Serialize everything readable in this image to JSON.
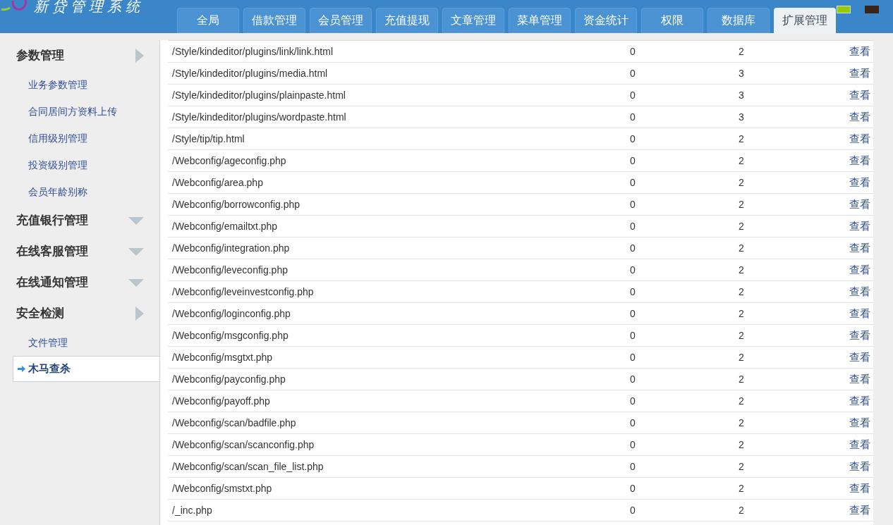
{
  "logo": {
    "title": "新贷管理系统"
  },
  "tabs": [
    {
      "label": "全局",
      "selected": false
    },
    {
      "label": "借款管理",
      "selected": false
    },
    {
      "label": "会员管理",
      "selected": false
    },
    {
      "label": "充值提现",
      "selected": false
    },
    {
      "label": "文章管理",
      "selected": false
    },
    {
      "label": "菜单管理",
      "selected": false
    },
    {
      "label": "资金统计",
      "selected": false
    },
    {
      "label": "权限",
      "selected": false
    },
    {
      "label": "数据库",
      "selected": false
    },
    {
      "label": "扩展管理",
      "selected": true
    }
  ],
  "sidebar": [
    {
      "label": "参数管理",
      "expanded": true,
      "children": [
        {
          "label": "业务参数管理",
          "selected": false
        },
        {
          "label": "合同居间方资料上传",
          "selected": false
        },
        {
          "label": "信用级别管理",
          "selected": false
        },
        {
          "label": "投资级别管理",
          "selected": false
        },
        {
          "label": "会员年龄别称",
          "selected": false
        }
      ]
    },
    {
      "label": "充值银行管理",
      "expanded": false
    },
    {
      "label": "在线客服管理",
      "expanded": false
    },
    {
      "label": "在线通知管理",
      "expanded": false
    },
    {
      "label": "安全检测",
      "expanded": true,
      "children": [
        {
          "label": "文件管理",
          "selected": false
        },
        {
          "label": "木马查杀",
          "selected": true
        }
      ]
    }
  ],
  "table": {
    "rows": [
      [
        "/Style/kindeditor/plugins/link/link.html",
        "0",
        "2",
        "查看"
      ],
      [
        "/Style/kindeditor/plugins/media.html",
        "0",
        "3",
        "查看"
      ],
      [
        "/Style/kindeditor/plugins/plainpaste.html",
        "0",
        "3",
        "查看"
      ],
      [
        "/Style/kindeditor/plugins/wordpaste.html",
        "0",
        "3",
        "查看"
      ],
      [
        "/Style/tip/tip.html",
        "0",
        "2",
        "查看"
      ],
      [
        "/Webconfig/ageconfig.php",
        "0",
        "2",
        "查看"
      ],
      [
        "/Webconfig/area.php",
        "0",
        "2",
        "查看"
      ],
      [
        "/Webconfig/borrowconfig.php",
        "0",
        "2",
        "查看"
      ],
      [
        "/Webconfig/emailtxt.php",
        "0",
        "2",
        "查看"
      ],
      [
        "/Webconfig/integration.php",
        "0",
        "2",
        "查看"
      ],
      [
        "/Webconfig/leveconfig.php",
        "0",
        "2",
        "查看"
      ],
      [
        "/Webconfig/leveinvestconfig.php",
        "0",
        "2",
        "查看"
      ],
      [
        "/Webconfig/loginconfig.php",
        "0",
        "2",
        "查看"
      ],
      [
        "/Webconfig/msgconfig.php",
        "0",
        "2",
        "查看"
      ],
      [
        "/Webconfig/msgtxt.php",
        "0",
        "2",
        "查看"
      ],
      [
        "/Webconfig/payconfig.php",
        "0",
        "2",
        "查看"
      ],
      [
        "/Webconfig/payoff.php",
        "0",
        "2",
        "查看"
      ],
      [
        "/Webconfig/scan/badfile.php",
        "0",
        "2",
        "查看"
      ],
      [
        "/Webconfig/scan/scanconfig.php",
        "0",
        "2",
        "查看"
      ],
      [
        "/Webconfig/scan/scan_file_list.php",
        "0",
        "2",
        "查看"
      ],
      [
        "/Webconfig/smstxt.php",
        "0",
        "2",
        "查看"
      ],
      [
        "/_inc.php",
        "0",
        "2",
        "查看"
      ]
    ]
  }
}
